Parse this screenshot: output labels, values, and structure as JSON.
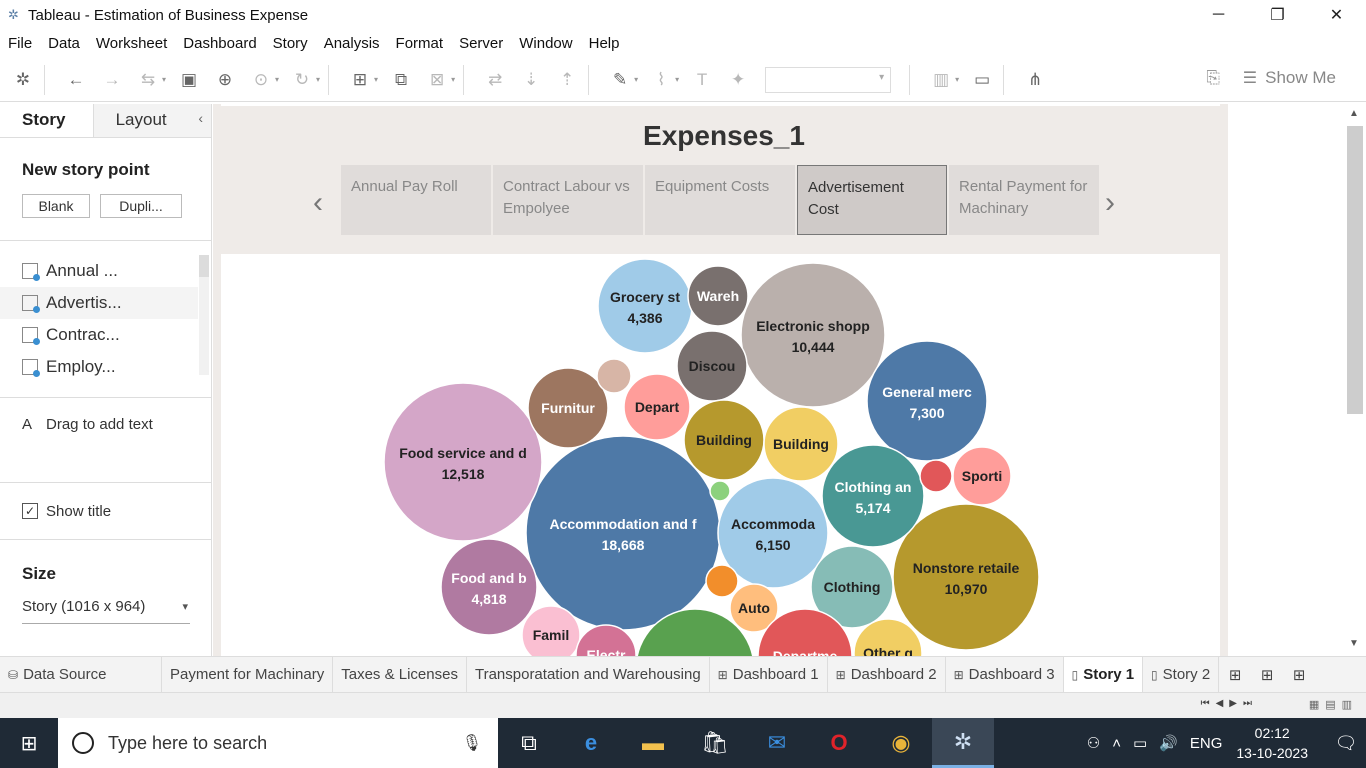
{
  "window": {
    "title": "Tableau - Estimation of Business Expense",
    "minimize": "─",
    "restore": "❐",
    "close": "✕"
  },
  "menu": [
    "File",
    "Data",
    "Worksheet",
    "Dashboard",
    "Story",
    "Analysis",
    "Format",
    "Server",
    "Window",
    "Help"
  ],
  "toolbar": {
    "show_me": "Show Me"
  },
  "left_panel": {
    "tab_story": "Story",
    "tab_layout": "Layout",
    "collapse": "‹",
    "new_story_point": "New story point",
    "blank_button": "Blank",
    "duplicate_button": "Dupli...",
    "story_points": [
      "Annual ...",
      "Advertis...",
      "Contrac...",
      "Employ..."
    ],
    "drag_text_icon": "A",
    "drag_text": "Drag to add text",
    "show_title_check": "✓",
    "show_title": "Show title",
    "size_title": "Size",
    "size_value": "Story (1016 x 964)"
  },
  "story": {
    "title": "Expenses_1",
    "prev": "‹",
    "next": "›",
    "points": [
      {
        "label": "Annual Pay Roll",
        "active": false
      },
      {
        "label": "Contract Labour vs Empolyee",
        "active": false
      },
      {
        "label": "Equipment Costs",
        "active": false
      },
      {
        "label": "Advertisement Cost",
        "active": true
      },
      {
        "label": "Rental Payment for Machinary",
        "active": false
      }
    ]
  },
  "chart_data": {
    "type": "packed-bubble",
    "bubbles": [
      {
        "label": "Accommodation and f",
        "value": "18,668",
        "color": "#4e79a7"
      },
      {
        "label": "Food service and d",
        "value": "12,518",
        "color": "#d4a6c8"
      },
      {
        "label": "Nonstore retaile",
        "value": "10,970",
        "color": "#b6992d"
      },
      {
        "label": "Electronic shopp",
        "value": "10,444",
        "color": "#bab0ac"
      },
      {
        "label": "General merc",
        "value": "7,300",
        "color": "#4e79a7"
      },
      {
        "label": "Accommoda",
        "value": "6,150",
        "color": "#a0cbe8"
      },
      {
        "label": "Clothing an",
        "value": "5,174",
        "color": "#499894"
      },
      {
        "label": "Food and b",
        "value": "4,818",
        "color": "#b07aa1"
      },
      {
        "label": "Grocery st",
        "value": "4,386",
        "color": "#a0cbe8"
      },
      {
        "label": "Wareh",
        "value": "",
        "color": "#79706e"
      },
      {
        "label": "Discou",
        "value": "",
        "color": "#79706e"
      },
      {
        "label": "Furnitur",
        "value": "",
        "color": "#9d7660"
      },
      {
        "label": "Depart",
        "value": "",
        "color": "#ff9d9a"
      },
      {
        "label": "Building",
        "value": "",
        "color": "#b6992d"
      },
      {
        "label": "Building",
        "value": "",
        "color": "#f1ce63"
      },
      {
        "label": "Sporti",
        "value": "",
        "color": "#ff9d9a"
      },
      {
        "label": "Clothing",
        "value": "",
        "color": "#86bcb6"
      },
      {
        "label": "Auto",
        "value": "",
        "color": "#ffbe7d"
      },
      {
        "label": "Famil",
        "value": "",
        "color": "#fabfd2"
      },
      {
        "label": "Departme",
        "value": "",
        "color": "#e15759"
      },
      {
        "label": "Other g",
        "value": "",
        "color": "#f1ce63"
      },
      {
        "label": "Electr",
        "value": "",
        "color": "#d37295"
      },
      {
        "label": "",
        "value": "",
        "color": "#59a14f"
      },
      {
        "label": "",
        "value": "",
        "color": "#d7b5a6"
      },
      {
        "label": "",
        "value": "",
        "color": "#e15759"
      },
      {
        "label": "",
        "value": "",
        "color": "#8cd17d"
      },
      {
        "label": "",
        "value": "",
        "color": "#f28e2b"
      }
    ]
  },
  "sheet_tabs": [
    {
      "label": "Data Source",
      "icon": "⛁",
      "active": false
    },
    {
      "label": "Payment for Machinary",
      "icon": "",
      "active": false
    },
    {
      "label": "Taxes & Licenses",
      "icon": "",
      "active": false
    },
    {
      "label": "Transporatation and Warehousing",
      "icon": "",
      "active": false
    },
    {
      "label": "Dashboard 1",
      "icon": "⊞",
      "active": false
    },
    {
      "label": "Dashboard 2",
      "icon": "⊞",
      "active": false
    },
    {
      "label": "Dashboard 3",
      "icon": "⊞",
      "active": false
    },
    {
      "label": "Story 1",
      "icon": "▯",
      "active": true
    },
    {
      "label": "Story 2",
      "icon": "▯",
      "active": false
    }
  ],
  "taskbar": {
    "search_placeholder": "Type here to search",
    "language": "ENG",
    "time": "02:12",
    "date": "13-10-2023"
  }
}
